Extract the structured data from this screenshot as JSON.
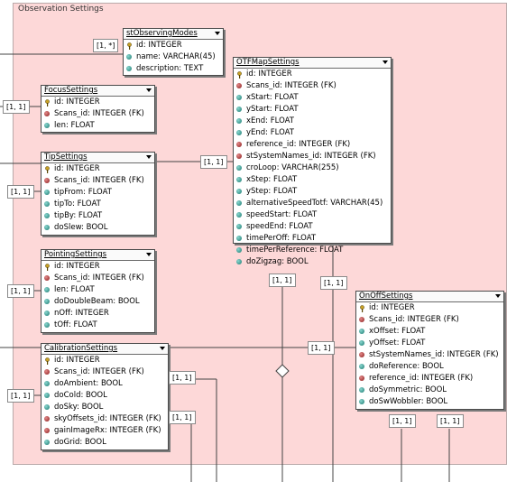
{
  "group": {
    "title": "Observation Settings"
  },
  "colors": {
    "group_bg": "#fdd8d8",
    "fk_dot": "#a33a3a",
    "column_dot": "#2a8a80",
    "line": "#444444"
  },
  "legend_icons": {
    "primary_key": "key-icon",
    "foreign_key": "red-dot-icon",
    "column": "teal-dot-icon"
  },
  "tables": {
    "stObservingModes": {
      "name": "stObservingModes",
      "columns": [
        "id: INTEGER",
        "name: VARCHAR(45)",
        "description: TEXT"
      ]
    },
    "FocusSettings": {
      "name": "FocusSettings",
      "columns": [
        "id: INTEGER",
        "Scans_id: INTEGER (FK)",
        "len: FLOAT"
      ]
    },
    "TipSettings": {
      "name": "TipSettings",
      "columns": [
        "id: INTEGER",
        "Scans_id: INTEGER (FK)",
        "tipFrom: FLOAT",
        "tipTo: FLOAT",
        "tipBy: FLOAT",
        "doSlew: BOOL"
      ]
    },
    "PointingSettings": {
      "name": "PointingSettings",
      "columns": [
        "id: INTEGER",
        "Scans_id: INTEGER (FK)",
        "len: FLOAT",
        "doDoubleBeam: BOOL",
        "nOff: INTEGER",
        "tOff: FLOAT"
      ]
    },
    "CalibrationSettings": {
      "name": "CalibrationSettings",
      "columns": [
        "id: INTEGER",
        "Scans_id: INTEGER (FK)",
        "doAmbient: BOOL",
        "doCold: BOOL",
        "doSky: BOOL",
        "skyOffsets_id: INTEGER (FK)",
        "gainImageRx: INTEGER (FK)",
        "doGrid: BOOL"
      ]
    },
    "OTFMapSettings": {
      "name": "OTFMapSettings",
      "columns": [
        "id: INTEGER",
        "Scans_id: INTEGER (FK)",
        "xStart: FLOAT",
        "yStart: FLOAT",
        "xEnd: FLOAT",
        "yEnd: FLOAT",
        "reference_id: INTEGER (FK)",
        "stSystemNames_id: INTEGER (FK)",
        "croLoop: VARCHAR(255)",
        "xStep: FLOAT",
        "yStep: FLOAT",
        "alternativeSpeedTotf: VARCHAR(45)",
        "speedStart: FLOAT",
        "speedEnd: FLOAT",
        "timePerOff: FLOAT",
        "timePerReference: FLOAT",
        "doZigzag: BOOL"
      ]
    },
    "OnOffSettings": {
      "name": "OnOffSettings",
      "columns": [
        "id: INTEGER",
        "Scans_id: INTEGER (FK)",
        "xOffset: FLOAT",
        "yOffset: FLOAT",
        "stSystemNames_id: INTEGER (FK)",
        "doReference: BOOL",
        "reference_id: INTEGER (FK)",
        "doSymmetric: BOOL",
        "doSwWobbler: BOOL"
      ]
    }
  },
  "cardinalities": {
    "stObservingModes": "[1, *]",
    "FocusSettings": "[1, 1]",
    "TipSettings": "[1, 1]",
    "TipOTF": "[1, 1]",
    "PointingSettings": "[1, 1]",
    "CalibrationSettings": "[1, 1]",
    "OTFLeft": "[1, 1]",
    "OTFRight": "[1, 1]",
    "OnOffLeft": "[1, 1]",
    "CalibRight1": "[1, 1]",
    "CalibRight2": "[1, 1]",
    "OnOffBottom1": "[1, 1]",
    "OnOffBottom2": "[1, 1]"
  }
}
